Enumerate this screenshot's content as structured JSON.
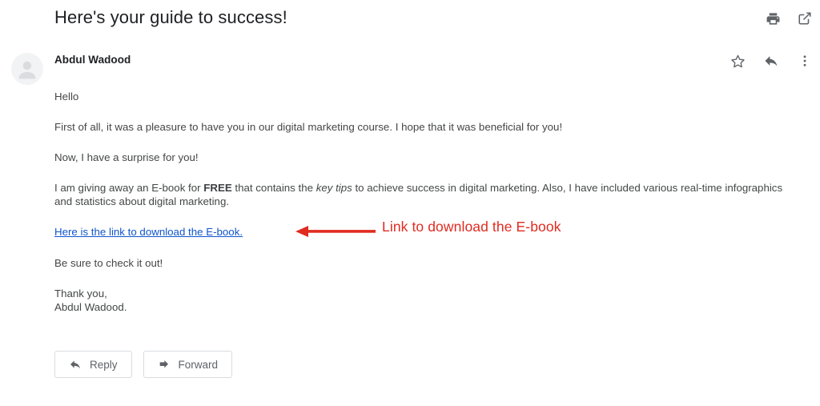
{
  "email": {
    "subject": "Here's your guide to success!",
    "sender_name": "Abdul Wadood",
    "header_icons": [
      {
        "name": "print-icon",
        "label": "Print"
      },
      {
        "name": "open-in-new-icon",
        "label": "Open in new window"
      }
    ],
    "sender_icons": [
      {
        "name": "star-icon",
        "label": "Star"
      },
      {
        "name": "reply-icon",
        "label": "Reply"
      },
      {
        "name": "more-options-icon",
        "label": "More"
      }
    ],
    "avatar": {
      "icon": "person-avatar-icon"
    },
    "body": {
      "greeting": "Hello",
      "paragraph_1": "First of all, it was a pleasure to have you in our digital marketing course. I hope that it was beneficial for you!",
      "paragraph_2": "Now, I have a surprise for you!",
      "paragraph_3_part_1": "I am giving away an E-book for ",
      "paragraph_3_bold": "FREE",
      "paragraph_3_part_2": " that contains the ",
      "paragraph_3_italic": "key tips",
      "paragraph_3_part_3": " to achieve success in digital marketing. Also, I have included various real-time infographics and statistics about digital marketing.",
      "link_text": "Here is the link to download the E-book.",
      "paragraph_4": "Be sure to check it out!",
      "signoff_line_1": "Thank you,",
      "signoff_line_2": "Abdul Wadood."
    },
    "annotation": {
      "text": "Link to download the E-book",
      "color": "#e02b20",
      "arrow": "left-arrow-annotation"
    },
    "footer_buttons": [
      {
        "name": "reply-button",
        "label": "Reply",
        "icon": "reply-arrow-icon"
      },
      {
        "name": "forward-button",
        "label": "Forward",
        "icon": "forward-arrow-icon"
      }
    ]
  },
  "theme": {
    "link_color": "#1155cc",
    "text_color": "#444746",
    "title_color": "#202124",
    "icon_color": "#5f6368",
    "annotation_color": "#e02b20",
    "background": "#ffffff"
  }
}
